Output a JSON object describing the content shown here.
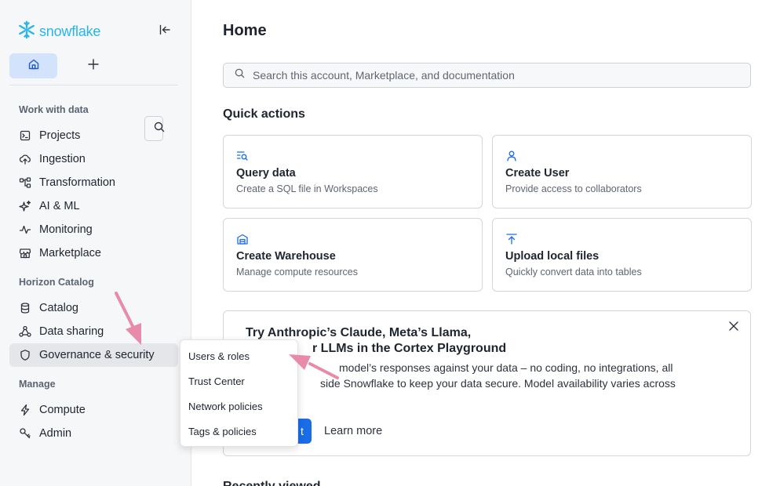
{
  "app": {
    "logo_text": "snowflake",
    "brand_color": "#29b5e8",
    "accent_color": "#1a6ce7"
  },
  "sidebar": {
    "top_buttons": [
      {
        "icon": "home-icon",
        "active": true
      },
      {
        "icon": "plus-icon"
      },
      {
        "icon": "search-icon"
      }
    ],
    "sections": [
      {
        "label": "Work with data",
        "items": [
          {
            "label": "Projects",
            "icon": "projects-icon"
          },
          {
            "label": "Ingestion",
            "icon": "cloud-upload-icon"
          },
          {
            "label": "Transformation",
            "icon": "transformation-icon"
          },
          {
            "label": "AI & ML",
            "icon": "sparkle-icon"
          },
          {
            "label": "Monitoring",
            "icon": "activity-icon"
          },
          {
            "label": "Marketplace",
            "icon": "store-icon"
          }
        ]
      },
      {
        "label": "Horizon Catalog",
        "items": [
          {
            "label": "Catalog",
            "icon": "database-icon"
          },
          {
            "label": "Data sharing",
            "icon": "share-icon"
          },
          {
            "label": "Governance & security",
            "icon": "shield-icon",
            "active": true
          }
        ]
      },
      {
        "label": "Manage",
        "items": [
          {
            "label": "Compute",
            "icon": "lightning-icon"
          },
          {
            "label": "Admin",
            "icon": "key-icon"
          }
        ]
      }
    ]
  },
  "main": {
    "title": "Home",
    "search": {
      "placeholder": "Search this account, Marketplace, and documentation"
    },
    "quick_actions": {
      "title": "Quick actions",
      "cards": [
        {
          "title": "Query data",
          "subtitle": "Create a SQL file in Workspaces",
          "icon": "query-icon"
        },
        {
          "title": "Create User",
          "subtitle": "Provide access to collaborators",
          "icon": "user-icon"
        },
        {
          "title": "Create Warehouse",
          "subtitle": "Manage compute resources",
          "icon": "warehouse-icon"
        },
        {
          "title": "Upload local files",
          "subtitle": "Quickly convert data into tables",
          "icon": "upload-icon"
        }
      ]
    },
    "promo": {
      "heading_line1": "Try Anthropic’s Claude, Meta’s Llama,",
      "heading_line2": "r LLMs in the Cortex Playground",
      "body_line1": "model’s responses against your data – no coding, no integrations, all",
      "body_line2": "side Snowflake to keep your data secure. Model availability varies across",
      "button_label": "t",
      "link_label": "Learn more"
    },
    "next_section_clipped": "Recently viewed"
  },
  "dropdown": {
    "items": [
      "Users & roles",
      "Trust Center",
      "Network policies",
      "Tags & policies"
    ]
  },
  "annotation": {
    "arrow_color": "#e88aaa"
  }
}
